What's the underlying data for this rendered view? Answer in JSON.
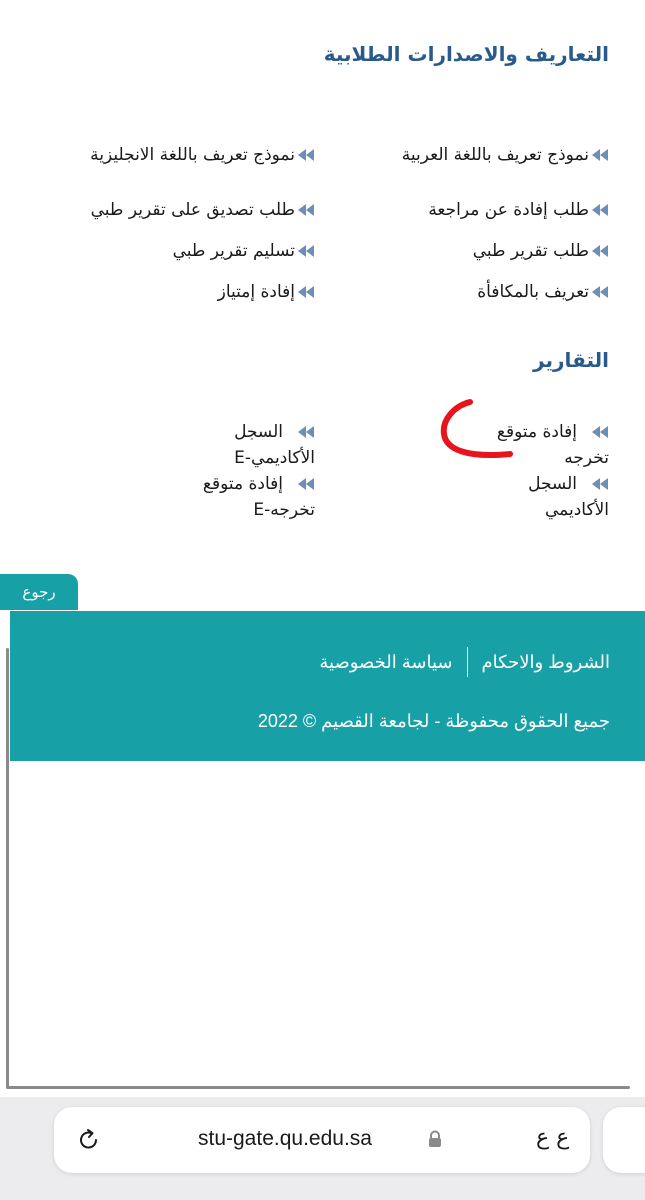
{
  "sections": {
    "certificates_title": "التعاريف والاصدارات الطلابية",
    "reports_title": "التقارير"
  },
  "certificates": {
    "right_column": [
      "نموذج تعريف باللغة العربية",
      "طلب إفادة عن مراجعة",
      "طلب تقرير طبي",
      "تعريف بالمكافأة"
    ],
    "left_column": [
      "نموذج تعريف باللغة الانجليزية",
      "طلب تصديق على تقرير طبي",
      "تسليم تقرير طبي",
      "إفادة إمتياز"
    ]
  },
  "reports": {
    "right": [
      {
        "line1": "إفادة متوقع",
        "line2": "تخرجه"
      },
      {
        "line1": "السجل",
        "line2": "الأكاديمي"
      }
    ],
    "left": [
      {
        "line1": "السجل",
        "line2": "الأكاديمي-E"
      },
      {
        "line1": "إفادة متوقع",
        "line2": "تخرجه-E"
      }
    ]
  },
  "footer": {
    "back_label": "رجوع",
    "terms_link": "الشروط والاحكام",
    "privacy_link": "سياسة الخصوصية",
    "copyright": "جميع الحقوق محفوظة - لجامعة القصيم © 2022"
  },
  "browser": {
    "url": "stu-gate.qu.edu.sa",
    "text_size_label": "ع ع"
  },
  "colors": {
    "heading": "#2a5a8c",
    "teal": "#17a0a6",
    "arrow": "#6d8fb5",
    "annotation": "#e8141b"
  },
  "icons": [
    "double-arrow-icon",
    "reload-icon",
    "lock-icon"
  ]
}
